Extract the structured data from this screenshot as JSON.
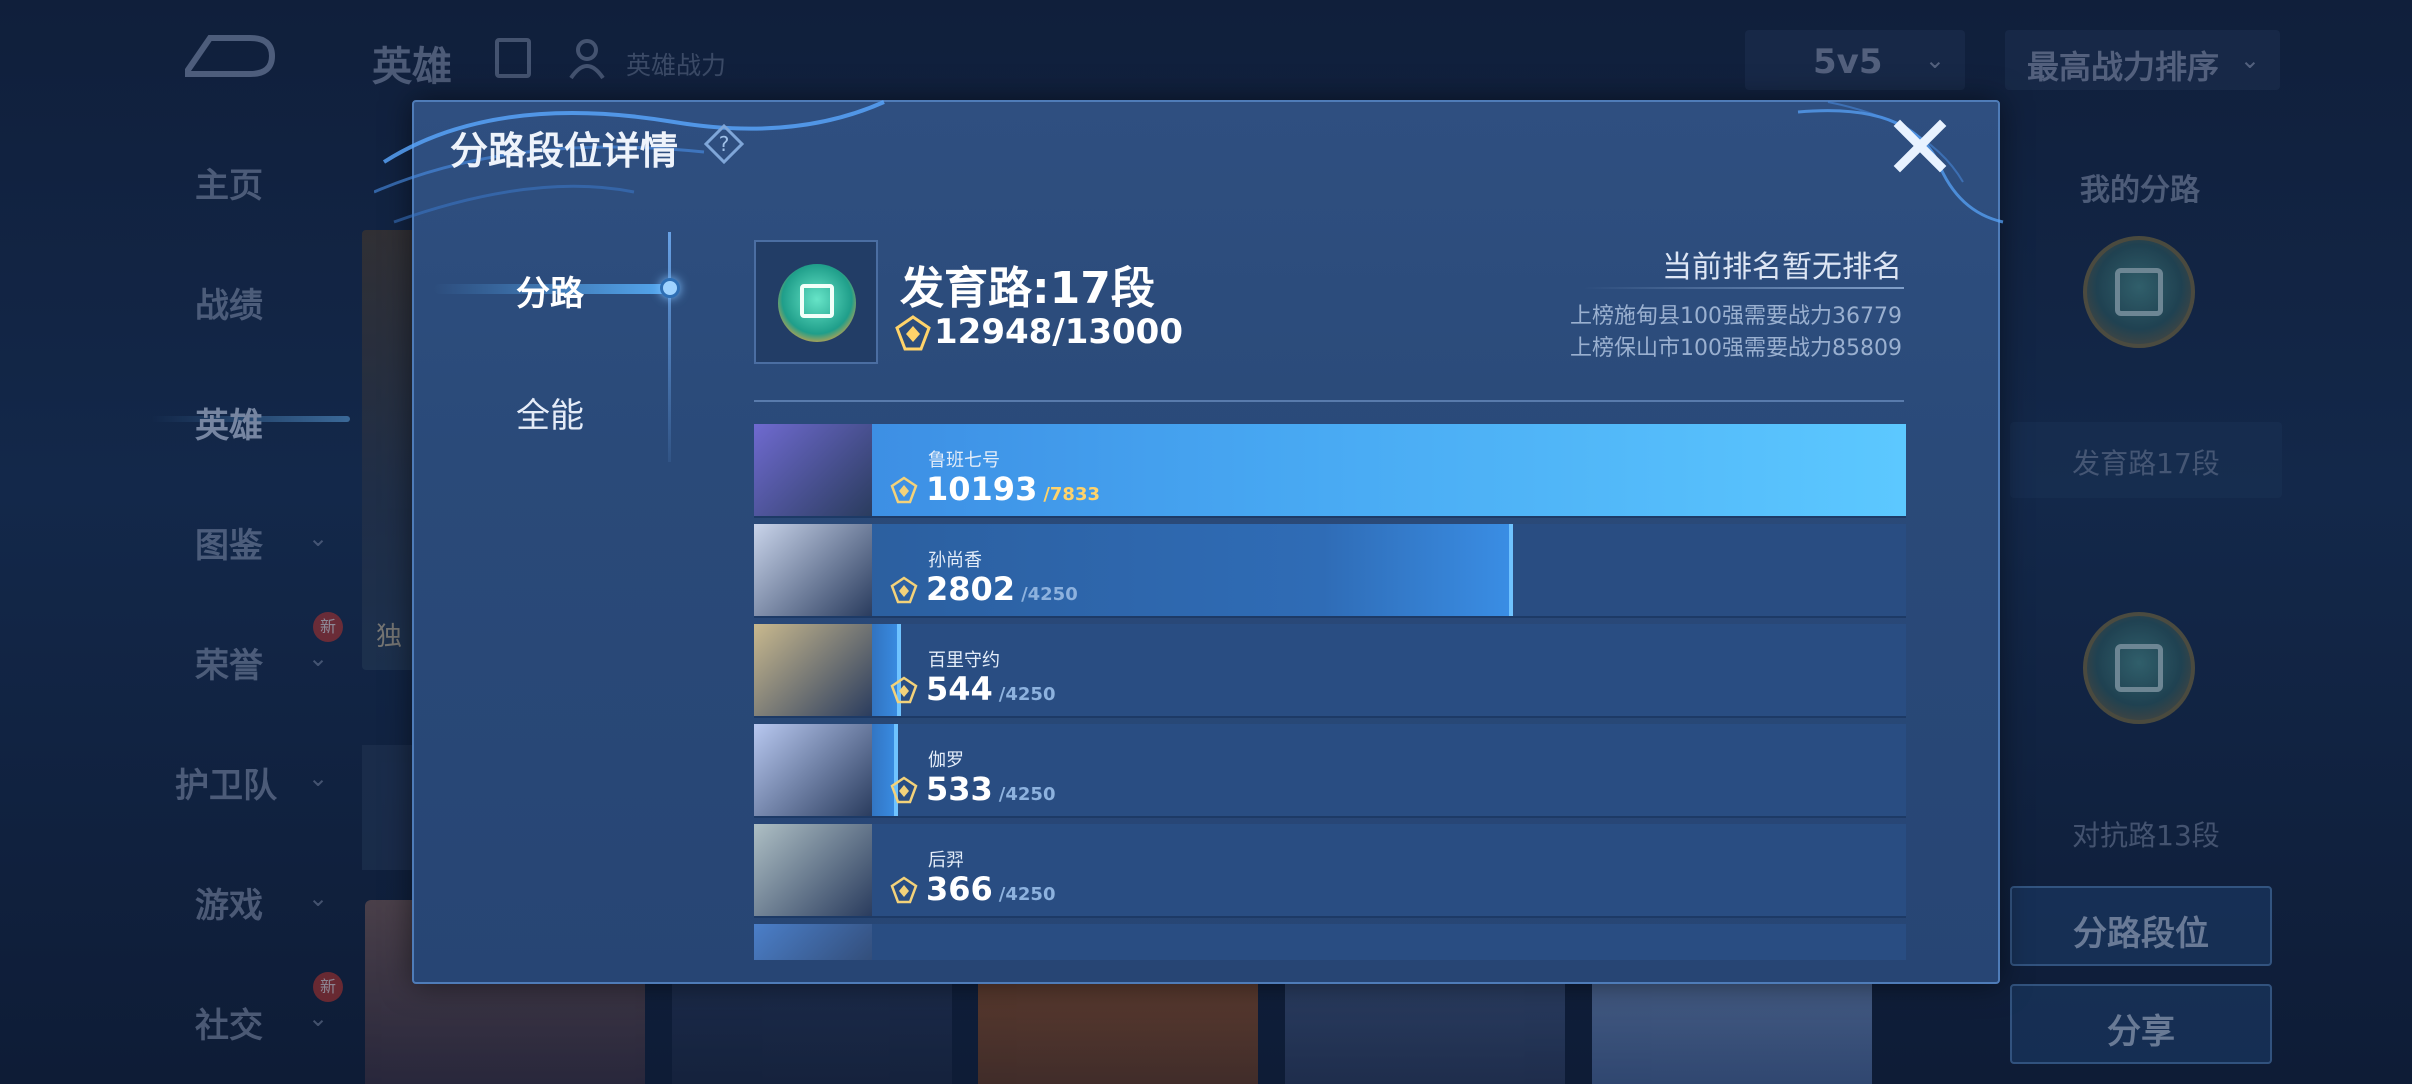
{
  "background": {
    "top_title": "英雄",
    "hero_power_label": "英雄战力",
    "mode_select": {
      "value": "5v5"
    },
    "sort_select": {
      "value": "最高战力排序"
    },
    "sidebar": {
      "items": [
        {
          "label": "主页"
        },
        {
          "label": "战绩"
        },
        {
          "label": "英雄"
        },
        {
          "label": "图鉴"
        },
        {
          "label": "荣誉",
          "badge": "新"
        },
        {
          "label": "护卫队"
        },
        {
          "label": "游戏"
        },
        {
          "label": "社交",
          "badge": "新"
        }
      ]
    },
    "hero_card_label": "独",
    "right_panel": {
      "title": "我的分路",
      "lane1": "发育路17段",
      "lane2": "对抗路13段",
      "lane_rank_button": "分路段位",
      "share_button": "分享"
    }
  },
  "dialog": {
    "title": "分路段位详情",
    "help_icon": "question-icon",
    "close_icon": "close-icon",
    "tabs": [
      {
        "label": "分路",
        "active": true
      },
      {
        "label": "全能",
        "active": false
      }
    ],
    "lane_title": "发育路:17段",
    "power_value": "12948/13000",
    "rank_status": "当前排名暂无排名",
    "rank_requirements": [
      "上榜施甸县100强需要战力36779",
      "上榜保山市100强需要战力85809"
    ],
    "heroes": [
      {
        "name": "鲁班七号",
        "power": "10193",
        "cap": "/7833",
        "progress": 1.0,
        "portrait_color": "#6f6ad0"
      },
      {
        "name": "孙尚香",
        "power": "2802",
        "cap": "/4250",
        "progress": 0.659,
        "portrait_color": "#c9d4ea"
      },
      {
        "name": "百里守约",
        "power": "544",
        "cap": "/4250",
        "progress": 0.128,
        "portrait_color": "#c9b98e"
      },
      {
        "name": "伽罗",
        "power": "533",
        "cap": "/4250",
        "progress": 0.125,
        "portrait_color": "#b8c8f0"
      },
      {
        "name": "后羿",
        "power": "366",
        "cap": "/4250",
        "progress": 0.086,
        "portrait_color": "#aebfc4"
      },
      {
        "name": "",
        "power": "",
        "cap": "",
        "progress": 0.086,
        "portrait_color": "#4b7fc9"
      }
    ]
  }
}
